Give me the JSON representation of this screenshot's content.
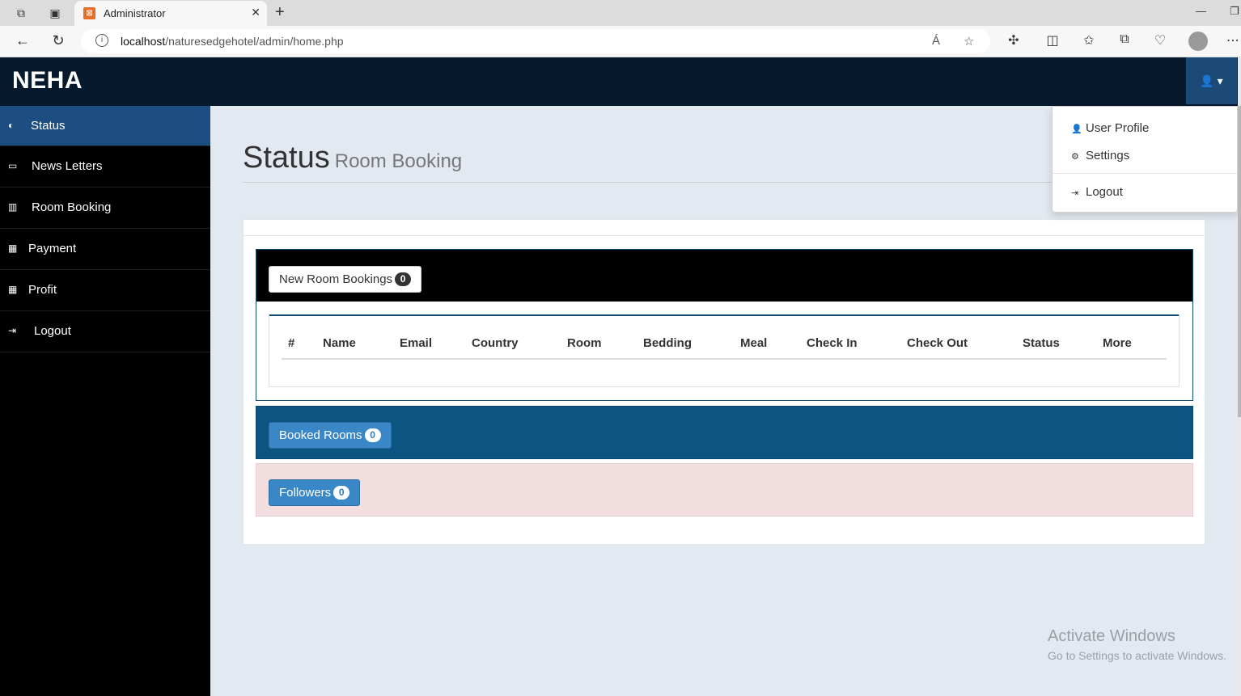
{
  "browser": {
    "tab_title": "Administrator",
    "url_host": "localhost",
    "url_path": "/naturesedgehotel/admin/home.php",
    "read_aloud": "Á"
  },
  "header": {
    "brand": "NEHA"
  },
  "sidebar": {
    "items": [
      {
        "label": "Status",
        "icon": "dashboard-icon"
      },
      {
        "label": "News Letters",
        "icon": "desktop-icon"
      },
      {
        "label": "Room Booking",
        "icon": "bar-chart-icon"
      },
      {
        "label": "Payment",
        "icon": "qrcode-icon"
      },
      {
        "label": "Profit",
        "icon": "qrcode-icon"
      },
      {
        "label": "Logout",
        "icon": "sign-out-icon"
      }
    ]
  },
  "main": {
    "title": "Status",
    "subtitle": "Room Booking",
    "new_bookings": {
      "label": "New Room Bookings",
      "count": "0"
    },
    "table_headers": [
      "#",
      "Name",
      "Email",
      "Country",
      "Room",
      "Bedding",
      "Meal",
      "Check In",
      "Check Out",
      "Status",
      "More"
    ],
    "booked_rooms": {
      "label": "Booked Rooms",
      "count": "0"
    },
    "followers": {
      "label": "Followers",
      "count": "0"
    }
  },
  "user_menu": {
    "items": [
      {
        "label": "User Profile",
        "icon": "user-icon"
      },
      {
        "label": "Settings",
        "icon": "gear-icon"
      },
      {
        "label": "Logout",
        "icon": "sign-out-icon"
      }
    ]
  },
  "watermark": {
    "title": "Activate Windows",
    "subtitle": "Go to Settings to activate Windows."
  },
  "colors": {
    "header_bg": "#071a2d",
    "sidebar_bg": "#000000",
    "sidebar_active": "#1c4e82",
    "booked_panel": "#0c5580",
    "followers_panel": "#f2dede",
    "button_blue": "#3a87c8"
  }
}
